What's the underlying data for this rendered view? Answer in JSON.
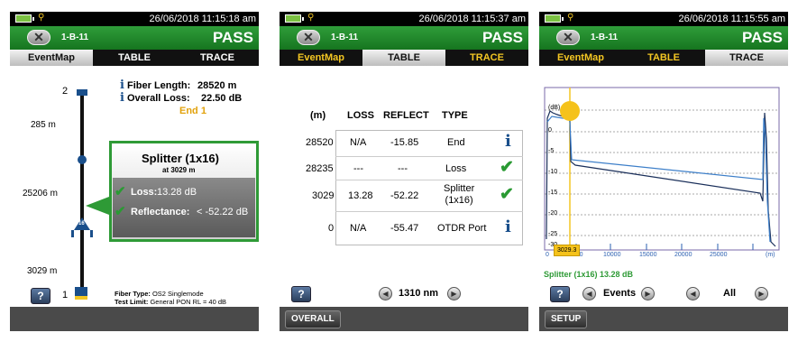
{
  "panels": [
    {
      "datetime": "26/06/2018 11:15:18 am",
      "test_id": "1-B-11",
      "result": "PASS",
      "tabs": [
        "EventMap",
        "TABLE",
        "TRACE"
      ],
      "fiber_length_label": "Fiber Length:",
      "fiber_length_value": "28520 m",
      "overall_loss_label": "Overall Loss:",
      "overall_loss_value": "22.50 dB",
      "end_label": "End 1",
      "map_labels": {
        "top_index": "2",
        "d1": "285 m",
        "d2": "25206 m",
        "d3": "3029 m",
        "bottom_index": "1",
        "splitter_badge": "16"
      },
      "callout": {
        "title": "Splitter (1x16)",
        "subtitle": "at 3029 m",
        "loss_label": "Loss:",
        "loss_value": "13.28 dB",
        "reflectance_label": "Reflectance:",
        "reflectance_value": "< -52.22 dB"
      },
      "fiber_type_label": "Fiber Type:",
      "fiber_type_value": "OS2 Singlemode",
      "test_limit_label": "Test Limit:",
      "test_limit_value": "General PON RL = 40 dB",
      "help_label": "?"
    },
    {
      "datetime": "26/06/2018 11:15:37 am",
      "test_id": "1-B-11",
      "result": "PASS",
      "tabs": [
        "EventMap",
        "TABLE",
        "TRACE"
      ],
      "columns": [
        "(m)",
        "LOSS",
        "REFLECT",
        "TYPE"
      ],
      "rows": [
        {
          "m": "28520",
          "loss": "N/A",
          "reflect": "-15.85",
          "type": "End",
          "icon": "info-icon"
        },
        {
          "m": "28235",
          "loss": "---",
          "reflect": "---",
          "type": "Loss",
          "icon": "check-icon"
        },
        {
          "m": "3029",
          "loss": "13.28",
          "reflect": "-52.22",
          "type": "Splitter\n(1x16)",
          "icon": "check-icon"
        },
        {
          "m": "0",
          "loss": "N/A",
          "reflect": "-55.47",
          "type": "OTDR Port",
          "icon": "info-icon"
        }
      ],
      "wavelength": "1310 nm",
      "help_label": "?",
      "bottom_button": "OVERALL"
    },
    {
      "datetime": "26/06/2018 11:15:55 am",
      "test_id": "1-B-11",
      "result": "PASS",
      "tabs": [
        "EventMap",
        "TABLE",
        "TRACE"
      ],
      "y_unit": "(dB)",
      "y_ticks": [
        "0",
        "-5",
        "-10",
        "-15",
        "-20",
        "-25",
        "-30"
      ],
      "x_ticks": [
        "0",
        "5000",
        "10000",
        "15000",
        "20000",
        "25000"
      ],
      "x_unit": "(m)",
      "cursor_label": "3029.3",
      "event_label": "Splitter (1x16) 13.28 dB",
      "events_label": "Events",
      "all_label": "All",
      "help_label": "?",
      "bottom_button": "SETUP"
    }
  ],
  "colors": {
    "pass_green": "#2f9d3a",
    "gold": "#f3c623",
    "info_blue": "#1a4f8b",
    "check_green": "#2a9a33"
  }
}
